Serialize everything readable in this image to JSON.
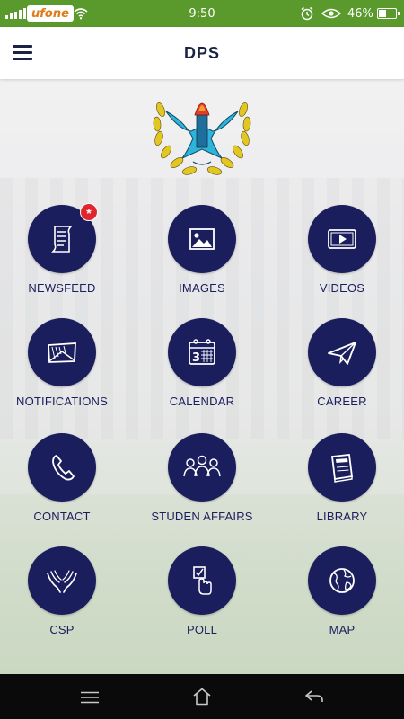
{
  "status_bar": {
    "carrier": "ufone",
    "time": "9:50",
    "battery": "46%",
    "battery_level": 0.46,
    "icons": [
      "signal-icon",
      "wifi-icon",
      "alarm-icon",
      "eye-icon",
      "battery-icon"
    ]
  },
  "app_bar": {
    "title": "DPS",
    "menu_icon": "hamburger-icon"
  },
  "colors": {
    "accent": "#1b1e5c",
    "status_bar": "#5a9a2c",
    "badge": "#e0262c",
    "nav_bar": "#0a0a0a"
  },
  "tiles": [
    {
      "label": "NEWSFEED",
      "icon": "scroll-icon",
      "badge": "*"
    },
    {
      "label": "IMAGES",
      "icon": "image-icon"
    },
    {
      "label": "VIDEOS",
      "icon": "video-icon"
    },
    {
      "label": "NOTIFICATIONS",
      "icon": "envelope-icon"
    },
    {
      "label": "CALENDAR",
      "icon": "calendar-icon"
    },
    {
      "label": "CAREER",
      "icon": "paper-plane-icon"
    },
    {
      "label": "CONTACT",
      "icon": "phone-icon"
    },
    {
      "label": "STUDEN AFFAIRS",
      "icon": "students-icon"
    },
    {
      "label": "LIBRARY",
      "icon": "book-icon"
    },
    {
      "label": "CSP",
      "icon": "hands-icon"
    },
    {
      "label": "POLL",
      "icon": "vote-icon"
    },
    {
      "label": "MAP",
      "icon": "globe-icon"
    }
  ],
  "nav_bar": {
    "buttons": [
      "menu-icon",
      "home-icon",
      "back-icon"
    ]
  }
}
